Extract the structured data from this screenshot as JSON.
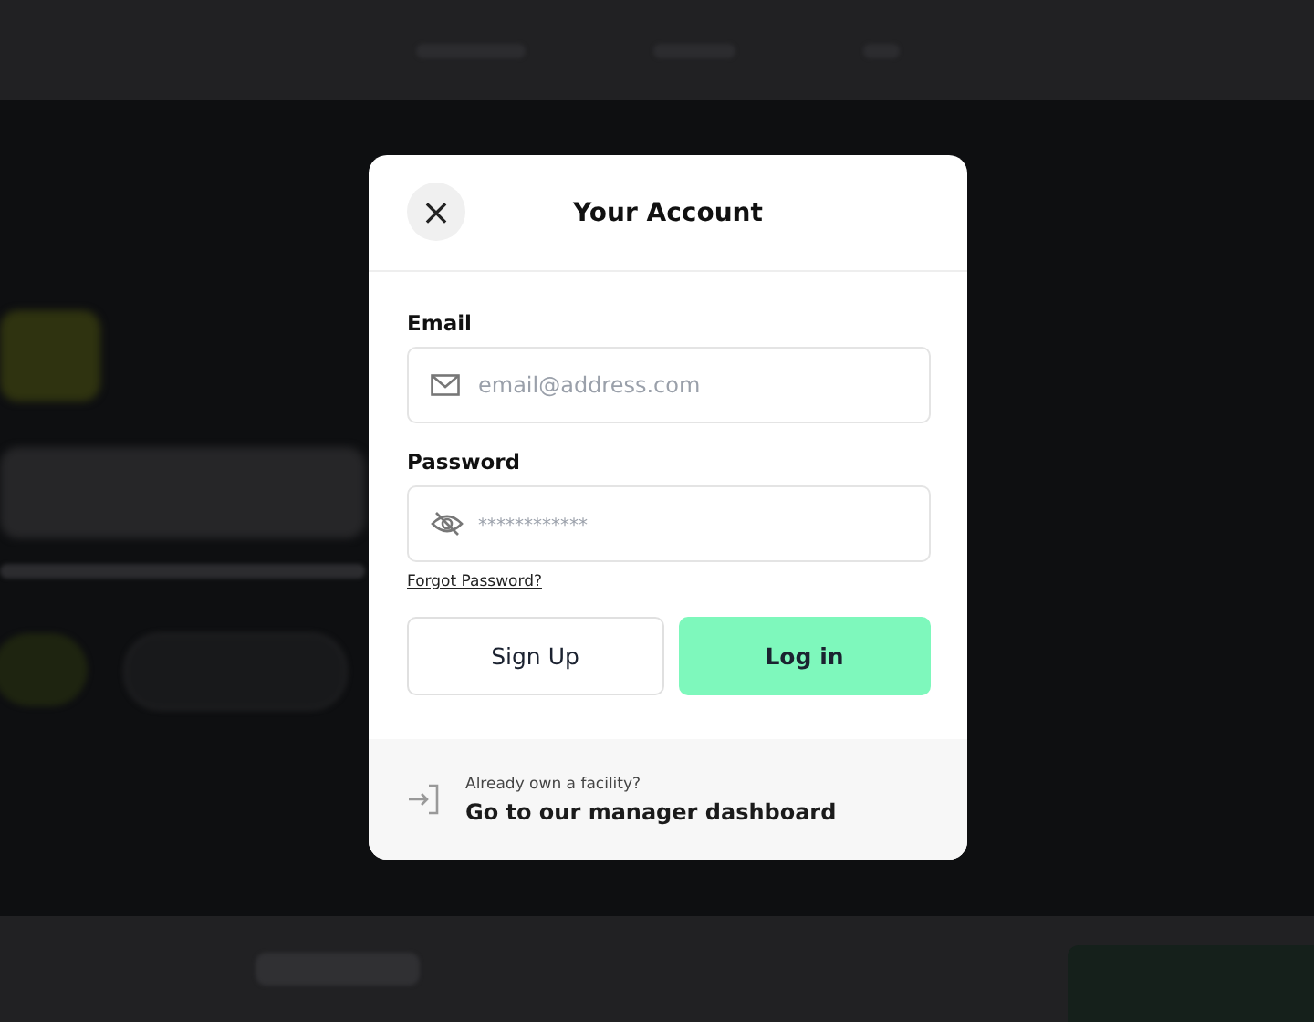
{
  "modal": {
    "title": "Your Account",
    "close_icon": "×",
    "fields": [
      {
        "label": "Email",
        "kind": "email",
        "placeholder": "email@address.com"
      },
      {
        "label": "Password",
        "kind": "password",
        "placeholder": "************"
      }
    ],
    "forgot_link": "Forgot Password?",
    "buttons": [
      {
        "label": "Sign Up",
        "kind": "secondary"
      },
      {
        "label": "Log in",
        "kind": "primary"
      }
    ],
    "footer": {
      "caption": "Already own a facility?",
      "link": "Go to our manager dashboard"
    }
  }
}
